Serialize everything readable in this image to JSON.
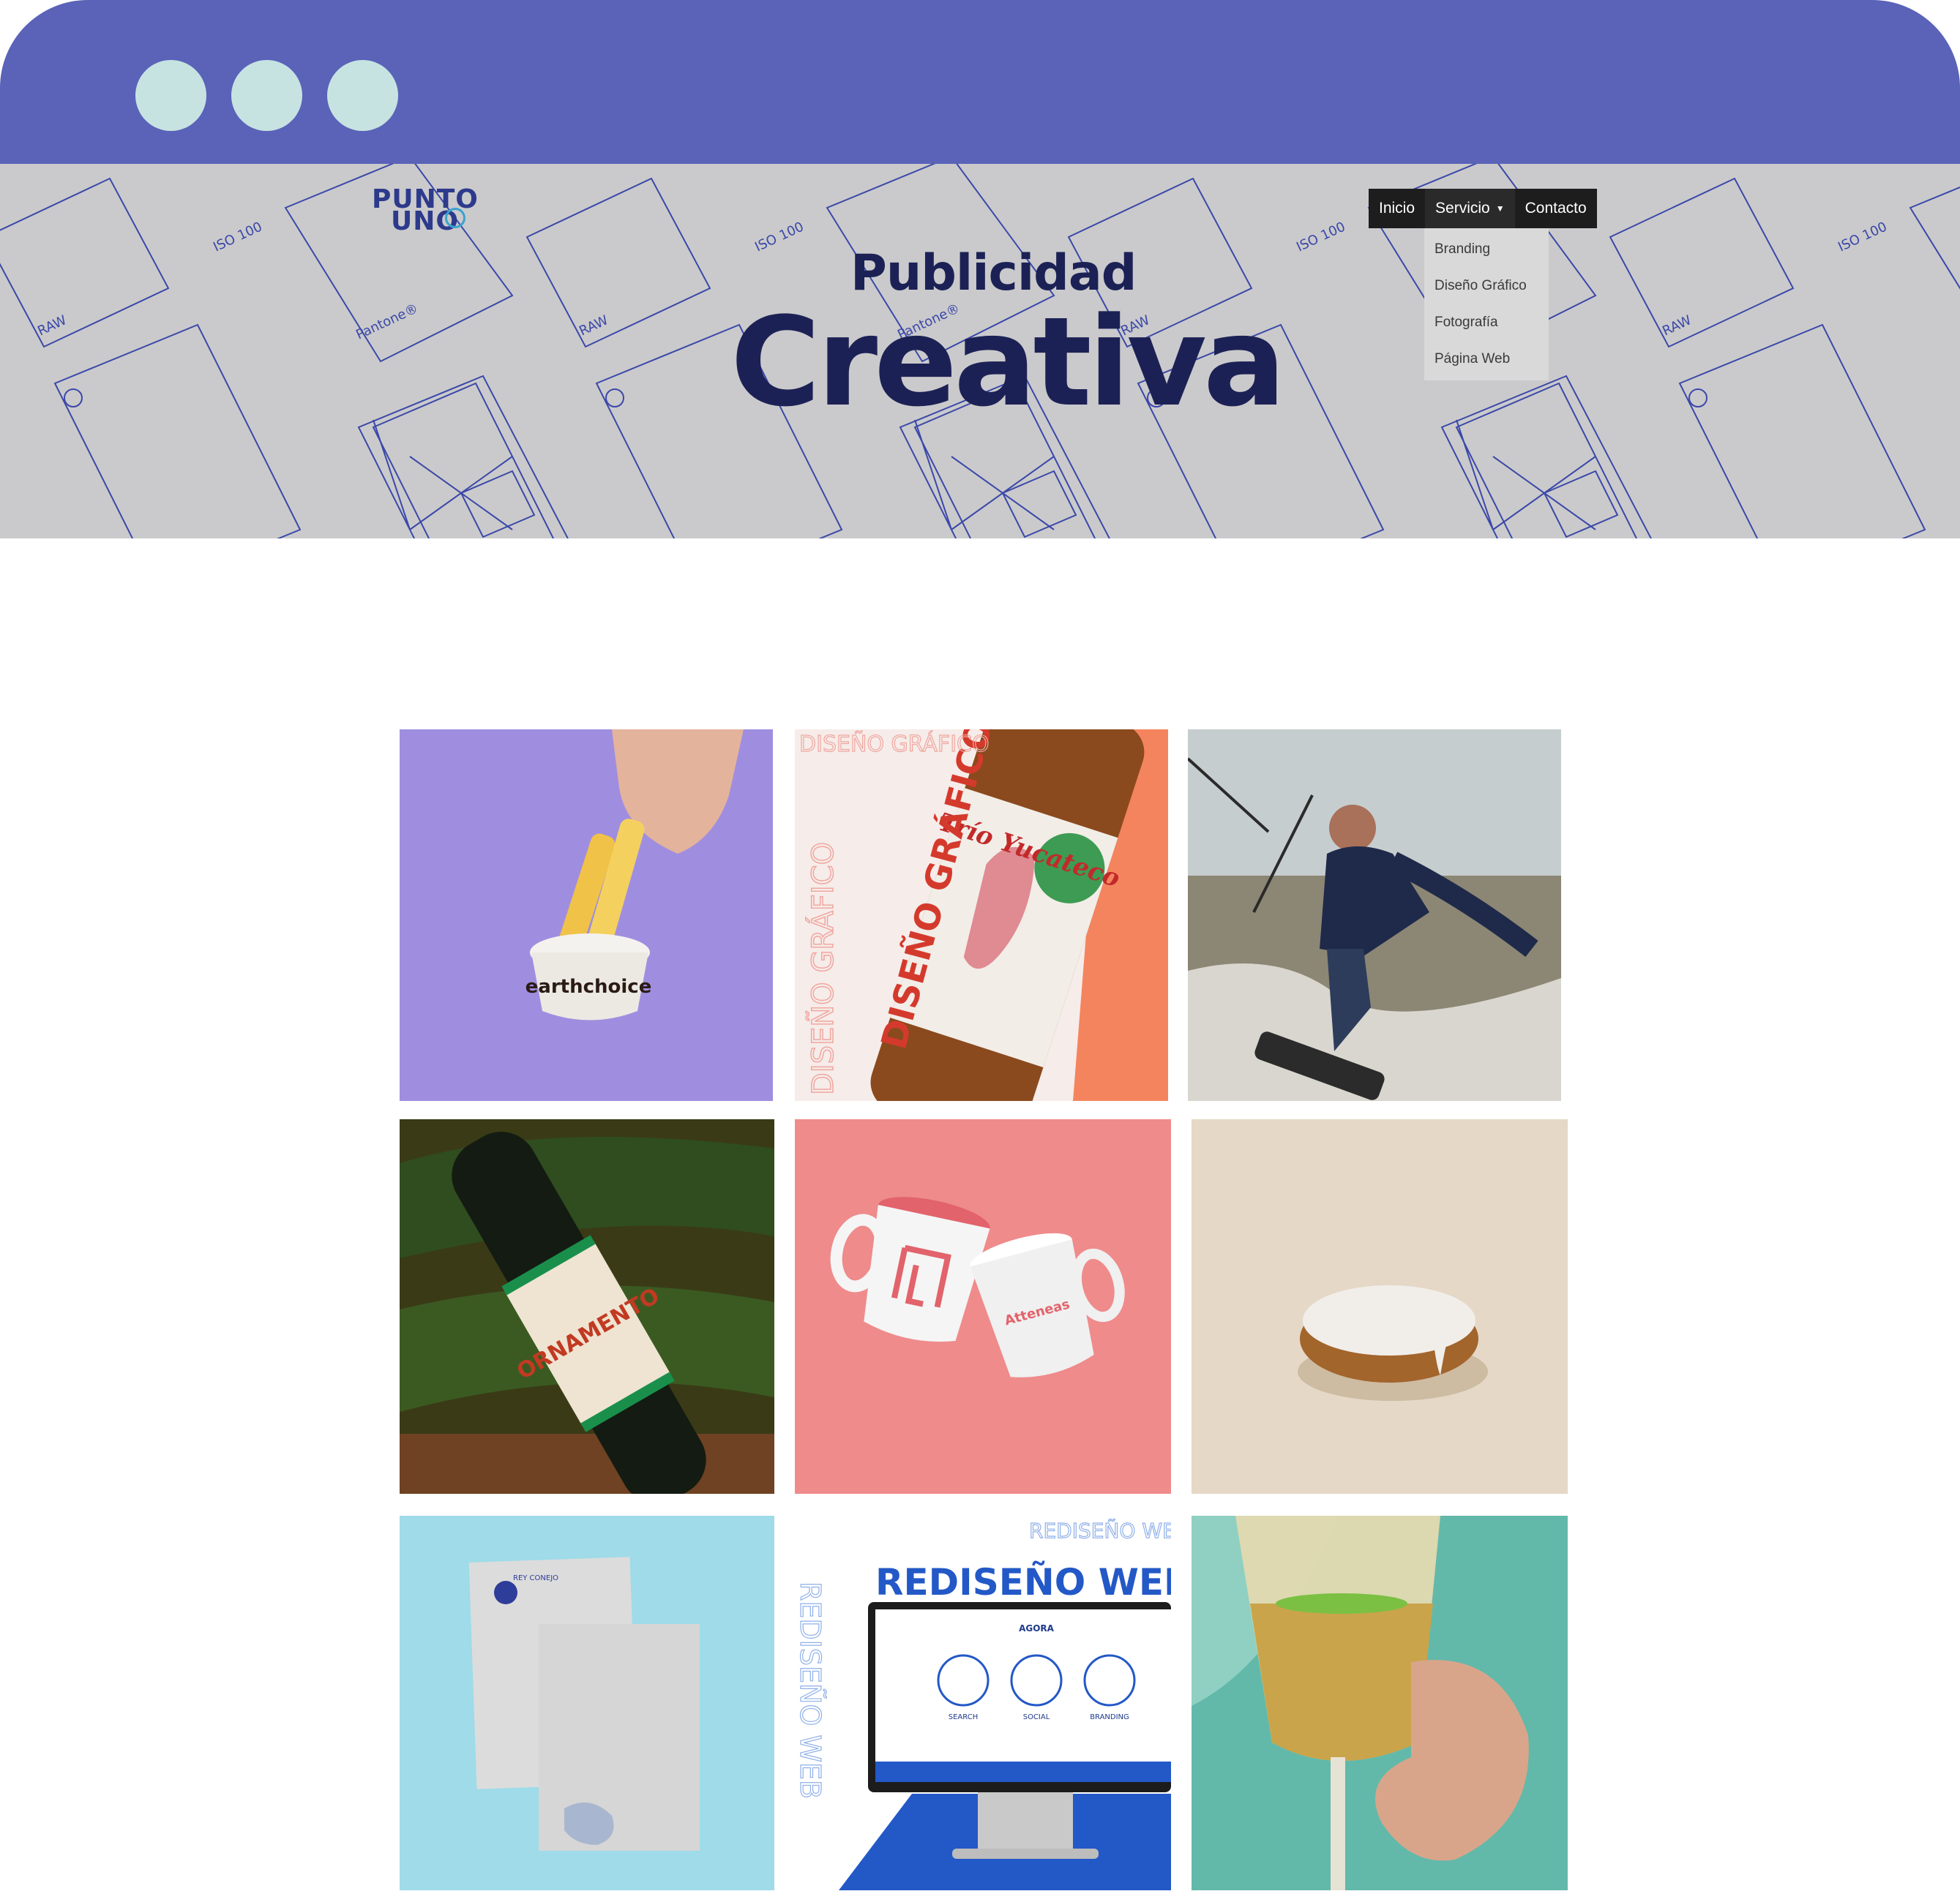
{
  "browser": {
    "controls": [
      "window-dot",
      "window-dot",
      "window-dot"
    ],
    "bar_color": "#5a63b8",
    "dot_color": "#c6e3e2"
  },
  "hero": {
    "logo_line1": "PUNTO",
    "logo_line2": "UNO",
    "title_small": "Publicidad",
    "title_large": "Creativa",
    "pattern_labels": [
      "ISO 100",
      "RAW",
      "Pantone®"
    ]
  },
  "nav": {
    "items": [
      {
        "label": "Inicio"
      },
      {
        "label": "Servicio",
        "caret": "▼"
      },
      {
        "label": "Contacto"
      }
    ],
    "dropdown": [
      "Branding",
      "Diseño Gráfico",
      "Fotografía",
      "Página Web"
    ]
  },
  "gallery": {
    "tiles": [
      {
        "id": "fries",
        "brand": "earthchoice",
        "bg": "#9f8ee0"
      },
      {
        "id": "beer-label",
        "label": "DISEÑO GRÁFICO",
        "beer_name": "Trío Yucateco",
        "bg": "#f3d4cc"
      },
      {
        "id": "kitesurf",
        "bg": "#b9c0c2"
      },
      {
        "id": "ornamento-bottle",
        "label": "ORNAMENTO",
        "bg": "#3b3a1c"
      },
      {
        "id": "mugs",
        "brand": "Atteneas",
        "bg": "#ef8b8b"
      },
      {
        "id": "pastry",
        "bg": "#e5d8c6"
      },
      {
        "id": "stationery",
        "brand": "REY CONEJO",
        "bg": "#9fdbe8"
      },
      {
        "id": "web-redesign",
        "label": "REDISEÑO WEB",
        "site_name": "AGORA",
        "sections": [
          "SEARCH",
          "SOCIAL",
          "BRANDING"
        ],
        "bg": "#ffffff"
      },
      {
        "id": "champagne",
        "bg": "#5fb8a9"
      }
    ]
  }
}
